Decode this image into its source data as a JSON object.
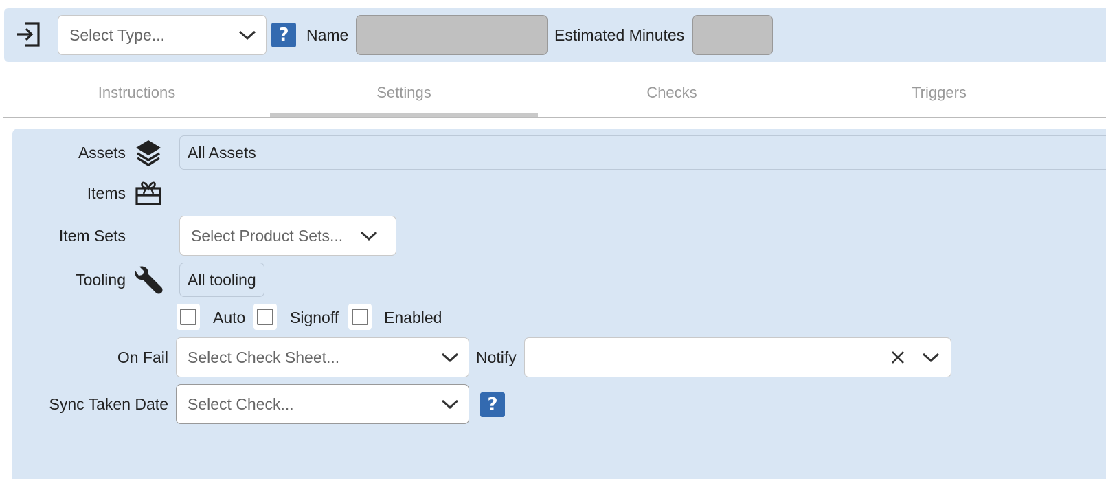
{
  "header": {
    "type_select_placeholder": "Select Type...",
    "name_label": "Name",
    "name_value": "",
    "estimated_minutes_label": "Estimated Minutes",
    "estimated_minutes_value": "",
    "help_glyph": "?"
  },
  "tabs": [
    {
      "label": "Instructions",
      "active": false
    },
    {
      "label": "Settings",
      "active": true
    },
    {
      "label": "Checks",
      "active": false
    },
    {
      "label": "Triggers",
      "active": false
    }
  ],
  "settings": {
    "assets_label": "Assets",
    "assets_value": "All Assets",
    "items_label": "Items",
    "item_sets_label": "Item Sets",
    "item_sets_placeholder": "Select Product Sets...",
    "tooling_label": "Tooling",
    "tooling_value": "All tooling",
    "checkboxes": [
      {
        "label": "Auto",
        "checked": false
      },
      {
        "label": "Signoff",
        "checked": false
      },
      {
        "label": "Enabled",
        "checked": false
      }
    ],
    "on_fail_label": "On Fail",
    "on_fail_placeholder": "Select Check Sheet...",
    "notify_label": "Notify",
    "notify_value": "",
    "sync_taken_date_label": "Sync Taken Date",
    "sync_placeholder": "Select Check...",
    "help_glyph": "?"
  },
  "icons": [
    "login-icon",
    "help-icon",
    "chevron-down-icon",
    "layers-icon",
    "gift-icon",
    "wrench-icon",
    "clear-x-icon"
  ],
  "colors": {
    "panel_bg": "#d9e6f4",
    "help_button": "#336ab0",
    "disabled_input": "#c0c0c0"
  }
}
